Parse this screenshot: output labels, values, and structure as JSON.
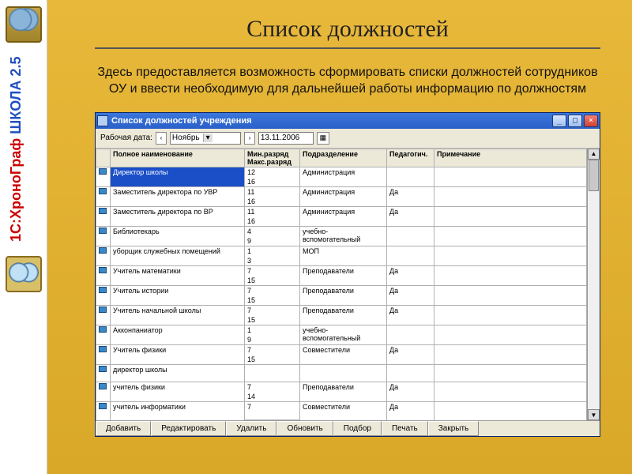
{
  "sidebar": {
    "product_line1": "1С:ХроноГраф",
    "product_line2": "ШКОЛА 2.5"
  },
  "page": {
    "title": "Список должностей",
    "description": "Здесь предоставляется возможность сформировать списки должностей сотрудников ОУ и ввести необходимую для дальнейшей работы информацию по должностям"
  },
  "window": {
    "title": "Список должностей учреждения",
    "minimize": "_",
    "maximize": "□",
    "close": "×"
  },
  "toolbar": {
    "label": "Рабочая дата:",
    "month": "Ноябрь",
    "date": "13.11.2006"
  },
  "columns": {
    "c0": "",
    "c1": "Полное наименование",
    "c2": "Мин.разряд\nМакс.разряд",
    "c3": "Подразделение",
    "c4": "Педагогич.",
    "c5": "Примечание"
  },
  "rows": [
    {
      "name": "Директор школы",
      "min": "12",
      "max": "16",
      "dept": "Администрация",
      "ped": "",
      "note": "",
      "sel": true
    },
    {
      "name": "Заместитель директора по УВР",
      "min": "11",
      "max": "16",
      "dept": "Администрация",
      "ped": "Да",
      "note": ""
    },
    {
      "name": "Заместитель директора по ВР",
      "min": "11",
      "max": "16",
      "dept": "Администрация",
      "ped": "Да",
      "note": ""
    },
    {
      "name": "Библиотекарь",
      "min": "4",
      "max": "9",
      "dept": "учебно-вспомогательный",
      "ped": "",
      "note": ""
    },
    {
      "name": "уборщик служебных помещений",
      "min": "1",
      "max": "3",
      "dept": "МОП",
      "ped": "",
      "note": ""
    },
    {
      "name": "Учитель математики",
      "min": "7",
      "max": "15",
      "dept": "Преподаватели",
      "ped": "Да",
      "note": ""
    },
    {
      "name": "Учитель истории",
      "min": "7",
      "max": "15",
      "dept": "Преподаватели",
      "ped": "Да",
      "note": ""
    },
    {
      "name": "Учитель начальной школы",
      "min": "7",
      "max": "15",
      "dept": "Преподаватели",
      "ped": "Да",
      "note": ""
    },
    {
      "name": "Акконпаниатор",
      "min": "1",
      "max": "9",
      "dept": "учебно-вспомогательный",
      "ped": "",
      "note": ""
    },
    {
      "name": "Учитель физики",
      "min": "7",
      "max": "15",
      "dept": "Совместители",
      "ped": "Да",
      "note": ""
    },
    {
      "name": "директор школы",
      "min": "",
      "max": "",
      "dept": "",
      "ped": "",
      "note": ""
    },
    {
      "name": "учитель физики",
      "min": "7",
      "max": "14",
      "dept": "Преподаватели",
      "ped": "Да",
      "note": ""
    },
    {
      "name": "учитель информатики",
      "min": "7",
      "max": "",
      "dept": "Совместители",
      "ped": "Да",
      "note": ""
    }
  ],
  "buttons": {
    "add": "Добавить",
    "edit": "Редактировать",
    "del": "Удалить",
    "refresh": "Обновить",
    "select": "Подбор",
    "print": "Печать",
    "close": "Закрыть"
  }
}
